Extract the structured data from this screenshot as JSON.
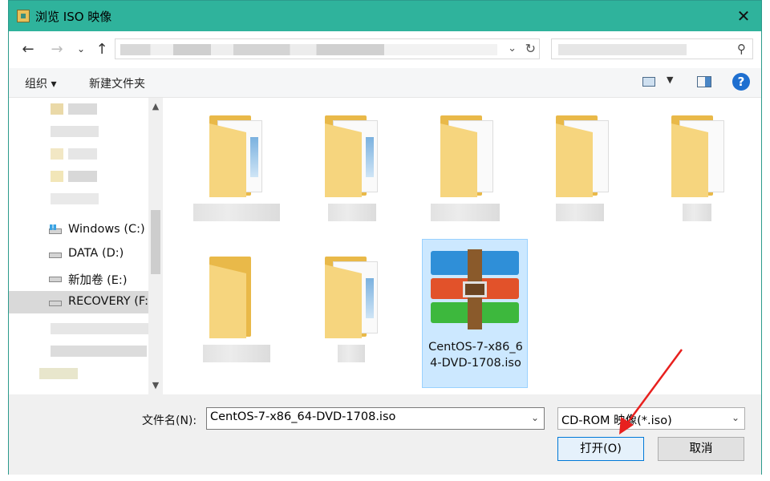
{
  "window": {
    "title": "浏览 ISO 映像"
  },
  "toolbar": {
    "organize": "组织 ▾",
    "new_folder": "新建文件夹",
    "help": "?"
  },
  "nav": {
    "drives": [
      {
        "label": "Windows (C:)"
      },
      {
        "label": "DATA (D:)"
      },
      {
        "label": "新加卷 (E:)"
      },
      {
        "label": "RECOVERY (F:)"
      }
    ]
  },
  "files": {
    "iso": {
      "name": "CentOS-7-x86_64-DVD-1708.iso"
    }
  },
  "footer": {
    "filename_label": "文件名(N):",
    "filename_value": "CentOS-7-x86_64-DVD-1708.iso",
    "filter_label": "CD-ROM 映像(*.iso)",
    "open_label": "打开(O)",
    "cancel_label": "取消"
  },
  "colors": {
    "titlebar": "#2fb39c",
    "selection": "#cce8ff",
    "arrow": "#e8201e"
  }
}
